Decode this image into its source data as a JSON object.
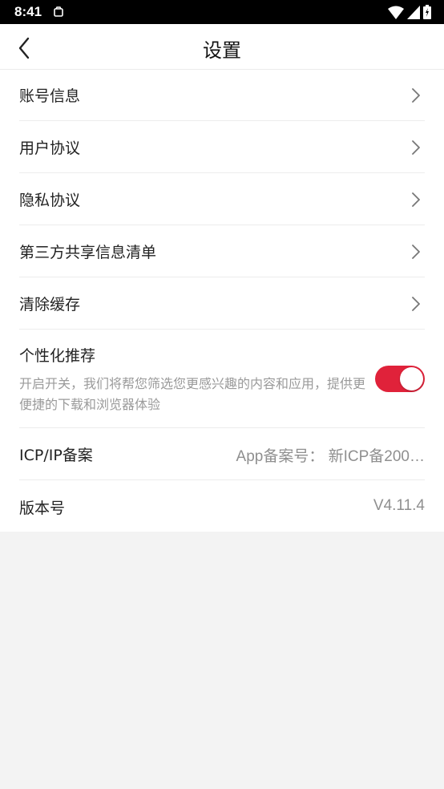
{
  "status_bar": {
    "time": "8:41"
  },
  "header": {
    "title": "设置"
  },
  "settings": {
    "items": [
      {
        "label": "账号信息"
      },
      {
        "label": "用户协议"
      },
      {
        "label": "隐私协议"
      },
      {
        "label": "第三方共享信息清单"
      },
      {
        "label": "清除缓存"
      }
    ],
    "personalization": {
      "label": "个性化推荐",
      "description": "开启开关，我们将帮您筛选您更感兴趣的内容和应用，提供更便捷的下载和浏览器体验",
      "enabled": true
    },
    "icp": {
      "label": "ICP/IP备案",
      "value": "App备案号： 新ICP备200…"
    },
    "version": {
      "label": "版本号",
      "value": "V4.11.4"
    }
  },
  "colors": {
    "accent": "#e0223a",
    "background": "#f3f3f3"
  }
}
